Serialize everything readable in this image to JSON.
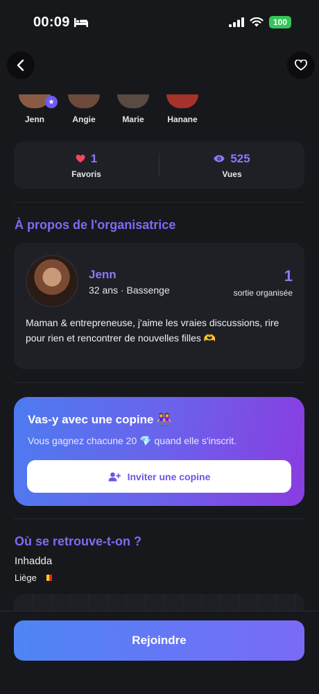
{
  "status_bar": {
    "time": "00:09",
    "battery": "100"
  },
  "participants": [
    {
      "name": "Jenn",
      "color": "#8a5a44",
      "organizer": true
    },
    {
      "name": "Angie",
      "color": "#6b4a3c"
    },
    {
      "name": "Marie",
      "color": "#5a4a44"
    },
    {
      "name": "Hanane",
      "color": "#a5322b"
    }
  ],
  "stats": {
    "favorites": {
      "value": "1",
      "label": "Favoris",
      "color": "#f2465d"
    },
    "views": {
      "value": "525",
      "label": "Vues",
      "color": "#8b79f7"
    }
  },
  "about": {
    "title": "À propos de l'organisatrice",
    "name": "Jenn",
    "meta": "32 ans · Bassenge",
    "count": "1",
    "count_label": "sortie organisée",
    "bio": "Maman & entrepreneuse, j'aime les vraies discussions, rire pour rien et rencontrer de nouvelles filles 🫶"
  },
  "invite": {
    "title": "Vas-y avec une copine 👭",
    "subtitle": "Vous gagnez chacune 20 💎  quand elle s'inscrit.",
    "button": "Inviter une copine"
  },
  "location": {
    "title": "Où se retrouve-t-on ?",
    "place": "Inhadda",
    "city": "Liège"
  },
  "cta": {
    "label": "Rejoindre"
  },
  "colors": {
    "accent": "#7d6bf5",
    "background": "#17181c",
    "card": "#1f2026"
  }
}
